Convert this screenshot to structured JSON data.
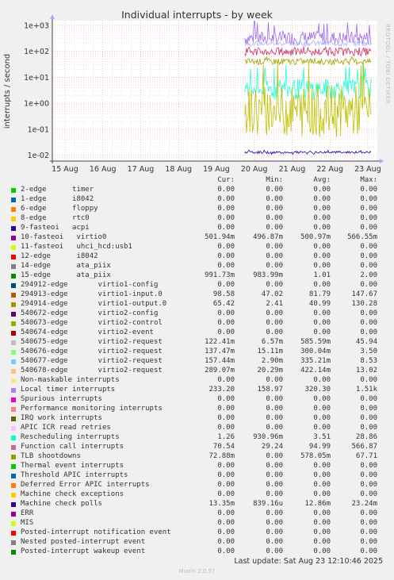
{
  "chart_data": {
    "type": "line",
    "title": "Individual interrupts - by week",
    "ylabel": "interrupts / second",
    "yscale": "log",
    "ylim": [
      0.006,
      1500
    ],
    "yticks": [
      "1e+03",
      "1e+02",
      "1e+01",
      "1e+00",
      "1e-01",
      "1e-02"
    ],
    "ytick_values": [
      1000,
      100,
      10,
      1,
      0.1,
      0.01
    ],
    "xticks": [
      "15 Aug",
      "16 Aug",
      "17 Aug",
      "18 Aug",
      "19 Aug",
      "20 Aug",
      "21 Aug",
      "22 Aug",
      "23 Aug"
    ],
    "data_start_day_index": 5,
    "series": [
      {
        "name": "Local timer interrupts",
        "color": "#9c6aee",
        "avg": 320.3,
        "min": 158.97,
        "max": 1510
      },
      {
        "name": "540676-edge virtio2-request",
        "color": "#b5b5ff",
        "avg": 200,
        "min": 120,
        "max": 300
      },
      {
        "name": "Function call interrupts",
        "color": "#cc3366",
        "avg": 95,
        "min": 40,
        "max": 150
      },
      {
        "name": "TLB shootdowns",
        "color": "#a3a300",
        "avg": 40,
        "min": 25,
        "max": 70
      },
      {
        "name": "Rescheduling interrupts",
        "color": "#22ffdd",
        "avg": 3.5,
        "min": 0.9,
        "max": 28.86
      },
      {
        "name": "540675-edge virtio2-request",
        "color": "#c0c000",
        "avg": 0.5,
        "min": 0.01,
        "max": 45
      },
      {
        "name": "Machine check polls",
        "color": "#2200aa",
        "avg": 0.013,
        "min": 0.011,
        "max": 0.016
      }
    ]
  },
  "legend": {
    "headers": [
      "Cur:",
      "Min:",
      "Avg:",
      "Max:"
    ],
    "rows": [
      {
        "color": "#00cc00",
        "name": "2-edge      timer",
        "cur": "0.00",
        "min": "0.00",
        "avg": "0.00",
        "max": "0.00"
      },
      {
        "color": "#0066b3",
        "name": "1-edge      i8042",
        "cur": "0.00",
        "min": "0.00",
        "avg": "0.00",
        "max": "0.00"
      },
      {
        "color": "#ff8000",
        "name": "6-edge      floppy",
        "cur": "0.00",
        "min": "0.00",
        "avg": "0.00",
        "max": "0.00"
      },
      {
        "color": "#ffcc00",
        "name": "8-edge      rtc0",
        "cur": "0.00",
        "min": "0.00",
        "avg": "0.00",
        "max": "0.00"
      },
      {
        "color": "#330099",
        "name": "9-fasteoi   acpi",
        "cur": "0.00",
        "min": "0.00",
        "avg": "0.00",
        "max": "0.00"
      },
      {
        "color": "#990099",
        "name": "10-fasteoi   virtio0",
        "cur": "501.94m",
        "min": "496.87m",
        "avg": "500.97m",
        "max": "566.55m"
      },
      {
        "color": "#ccff00",
        "name": "11-fasteoi   uhci_hcd:usb1",
        "cur": "0.00",
        "min": "0.00",
        "avg": "0.00",
        "max": "0.00"
      },
      {
        "color": "#ff0000",
        "name": "12-edge      i8042",
        "cur": "0.00",
        "min": "0.00",
        "avg": "0.00",
        "max": "0.00"
      },
      {
        "color": "#808080",
        "name": "14-edge      ata_piix",
        "cur": "0.00",
        "min": "0.00",
        "avg": "0.00",
        "max": "0.00"
      },
      {
        "color": "#008f00",
        "name": "15-edge      ata_piix",
        "cur": "991.73m",
        "min": "983.99m",
        "avg": "1.01",
        "max": "2.00"
      },
      {
        "color": "#00487d",
        "name": "294912-edge       virtio1-config",
        "cur": "0.00",
        "min": "0.00",
        "avg": "0.00",
        "max": "0.00"
      },
      {
        "color": "#b35a00",
        "name": "294913-edge       virtio1-input.0",
        "cur": "98.58",
        "min": "47.02",
        "avg": "81.79",
        "max": "147.67"
      },
      {
        "color": "#b38f00",
        "name": "294914-edge       virtio1-output.0",
        "cur": "65.42",
        "min": "2.41",
        "avg": "40.99",
        "max": "130.28"
      },
      {
        "color": "#6b006b",
        "name": "540672-edge       virtio2-config",
        "cur": "0.00",
        "min": "0.00",
        "avg": "0.00",
        "max": "0.00"
      },
      {
        "color": "#8fb300",
        "name": "540673-edge       virtio2-control",
        "cur": "0.00",
        "min": "0.00",
        "avg": "0.00",
        "max": "0.00"
      },
      {
        "color": "#b30000",
        "name": "540674-edge       virtio2-event",
        "cur": "0.00",
        "min": "0.00",
        "avg": "0.00",
        "max": "0.00"
      },
      {
        "color": "#bebebe",
        "name": "540675-edge       virtio2-request",
        "cur": "122.41m",
        "min": "6.57m",
        "avg": "585.59m",
        "max": "45.94"
      },
      {
        "color": "#80ff80",
        "name": "540676-edge       virtio2-request",
        "cur": "137.47m",
        "min": "15.11m",
        "avg": "300.04m",
        "max": "3.50"
      },
      {
        "color": "#80c9ff",
        "name": "540677-edge       virtio2-request",
        "cur": "157.44m",
        "min": "2.90m",
        "avg": "335.21m",
        "max": "8.53"
      },
      {
        "color": "#ffc080",
        "name": "540678-edge       virtio2-request",
        "cur": "289.07m",
        "min": "20.29m",
        "avg": "422.14m",
        "max": "13.02"
      },
      {
        "color": "#ffe680",
        "name": "Non-maskable interrupts",
        "cur": "0.00",
        "min": "0.00",
        "avg": "0.00",
        "max": "0.00"
      },
      {
        "color": "#aa80ff",
        "name": "Local timer interrupts",
        "cur": "233.20",
        "min": "158.97",
        "avg": "320.30",
        "max": "1.51k"
      },
      {
        "color": "#ee00cc",
        "name": "Spurious interrupts",
        "cur": "0.00",
        "min": "0.00",
        "avg": "0.00",
        "max": "0.00"
      },
      {
        "color": "#ff8080",
        "name": "Performance monitoring interrupts",
        "cur": "0.00",
        "min": "0.00",
        "avg": "0.00",
        "max": "0.00"
      },
      {
        "color": "#666600",
        "name": "IRQ work interrupts",
        "cur": "0.00",
        "min": "0.00",
        "avg": "0.00",
        "max": "0.00"
      },
      {
        "color": "#ffbfff",
        "name": "APIC ICR read retries",
        "cur": "0.00",
        "min": "0.00",
        "avg": "0.00",
        "max": "0.00"
      },
      {
        "color": "#00ffcc",
        "name": "Rescheduling interrupts",
        "cur": "1.26",
        "min": "930.96m",
        "avg": "3.51",
        "max": "28.86"
      },
      {
        "color": "#cc6699",
        "name": "Function call interrupts",
        "cur": "70.54",
        "min": "29.24",
        "avg": "94.99",
        "max": "566.87"
      },
      {
        "color": "#999900",
        "name": "TLB shootdowns",
        "cur": "72.88m",
        "min": "0.00",
        "avg": "578.05m",
        "max": "67.71"
      },
      {
        "color": "#00cc00",
        "name": "Thermal event interrupts",
        "cur": "0.00",
        "min": "0.00",
        "avg": "0.00",
        "max": "0.00"
      },
      {
        "color": "#0066b3",
        "name": "Threshold APIC interrupts",
        "cur": "0.00",
        "min": "0.00",
        "avg": "0.00",
        "max": "0.00"
      },
      {
        "color": "#ff8000",
        "name": "Deferred Error APIC interrupts",
        "cur": "0.00",
        "min": "0.00",
        "avg": "0.00",
        "max": "0.00"
      },
      {
        "color": "#ffcc00",
        "name": "Machine check exceptions",
        "cur": "0.00",
        "min": "0.00",
        "avg": "0.00",
        "max": "0.00"
      },
      {
        "color": "#330099",
        "name": "Machine check polls",
        "cur": "13.35m",
        "min": "839.16u",
        "avg": "12.86m",
        "max": "23.24m"
      },
      {
        "color": "#990099",
        "name": "ERR",
        "cur": "0.00",
        "min": "0.00",
        "avg": "0.00",
        "max": "0.00"
      },
      {
        "color": "#ccff00",
        "name": "MIS",
        "cur": "0.00",
        "min": "0.00",
        "avg": "0.00",
        "max": "0.00"
      },
      {
        "color": "#ff0000",
        "name": "Posted-interrupt notification event",
        "cur": "0.00",
        "min": "0.00",
        "avg": "0.00",
        "max": "0.00"
      },
      {
        "color": "#808080",
        "name": "Nested posted-interrupt event",
        "cur": "0.00",
        "min": "0.00",
        "avg": "0.00",
        "max": "0.00"
      },
      {
        "color": "#008f00",
        "name": "Posted-interrupt wakeup event",
        "cur": "0.00",
        "min": "0.00",
        "avg": "0.00",
        "max": "0.00"
      }
    ]
  },
  "footer": {
    "last_update": "Last update: Sat Aug 23 12:10:46 2025",
    "munin_version": "Munin 2.0.57",
    "watermark": "RRDTOOL / TOBI OETIKER"
  }
}
